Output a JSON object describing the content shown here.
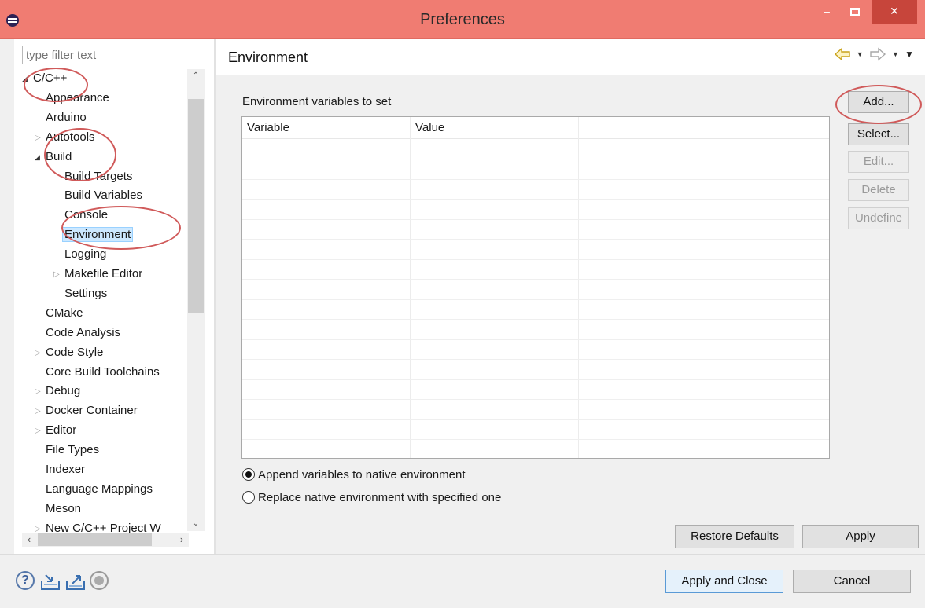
{
  "window": {
    "title": "Preferences",
    "controls": {
      "minimize": "‒",
      "close": "✕"
    }
  },
  "left": {
    "filter_placeholder": "type filter text",
    "tree": [
      {
        "label": "C/C++",
        "level": 0,
        "twisty": "expanded"
      },
      {
        "label": "Appearance",
        "level": 1,
        "twisty": "none"
      },
      {
        "label": "Arduino",
        "level": 1,
        "twisty": "none"
      },
      {
        "label": "Autotools",
        "level": 1,
        "twisty": "collapsed"
      },
      {
        "label": "Build",
        "level": 1,
        "twisty": "expanded"
      },
      {
        "label": "Build Targets",
        "level": 2,
        "twisty": "none"
      },
      {
        "label": "Build Variables",
        "level": 2,
        "twisty": "none"
      },
      {
        "label": "Console",
        "level": 2,
        "twisty": "none"
      },
      {
        "label": "Environment",
        "level": 2,
        "twisty": "none",
        "selected": true
      },
      {
        "label": "Logging",
        "level": 2,
        "twisty": "none"
      },
      {
        "label": "Makefile Editor",
        "level": 2,
        "twisty": "collapsed"
      },
      {
        "label": "Settings",
        "level": 2,
        "twisty": "none"
      },
      {
        "label": "CMake",
        "level": 1,
        "twisty": "none"
      },
      {
        "label": "Code Analysis",
        "level": 1,
        "twisty": "none"
      },
      {
        "label": "Code Style",
        "level": 1,
        "twisty": "collapsed"
      },
      {
        "label": "Core Build Toolchains",
        "level": 1,
        "twisty": "none"
      },
      {
        "label": "Debug",
        "level": 1,
        "twisty": "collapsed"
      },
      {
        "label": "Docker Container",
        "level": 1,
        "twisty": "collapsed"
      },
      {
        "label": "Editor",
        "level": 1,
        "twisty": "collapsed"
      },
      {
        "label": "File Types",
        "level": 1,
        "twisty": "none"
      },
      {
        "label": "Indexer",
        "level": 1,
        "twisty": "none"
      },
      {
        "label": "Language Mappings",
        "level": 1,
        "twisty": "none"
      },
      {
        "label": "Meson",
        "level": 1,
        "twisty": "none"
      },
      {
        "label": "New C/C++ Project W",
        "level": 1,
        "twisty": "collapsed"
      }
    ]
  },
  "main": {
    "page_title": "Environment",
    "section_label": "Environment variables to set",
    "table": {
      "columns": [
        "Variable",
        "Value",
        ""
      ],
      "rows": []
    },
    "side_buttons": [
      {
        "label": "Add...",
        "enabled": true
      },
      {
        "label": "Select...",
        "enabled": true
      },
      {
        "label": "Edit...",
        "enabled": false
      },
      {
        "label": "Delete",
        "enabled": false
      },
      {
        "label": "Undefine",
        "enabled": false
      }
    ],
    "radios": [
      {
        "label": "Append variables to native environment",
        "checked": true
      },
      {
        "label": "Replace native environment with specified one",
        "checked": false
      }
    ],
    "restore_defaults_label": "Restore Defaults",
    "apply_label": "Apply"
  },
  "footer": {
    "help_icon_glyph": "?",
    "apply_close_label": "Apply and Close",
    "cancel_label": "Cancel"
  },
  "colors": {
    "titlebar": "#f07c72",
    "close_button": "#c7453b",
    "selection": "#cce8ff",
    "annotation": "#d05a5a"
  }
}
